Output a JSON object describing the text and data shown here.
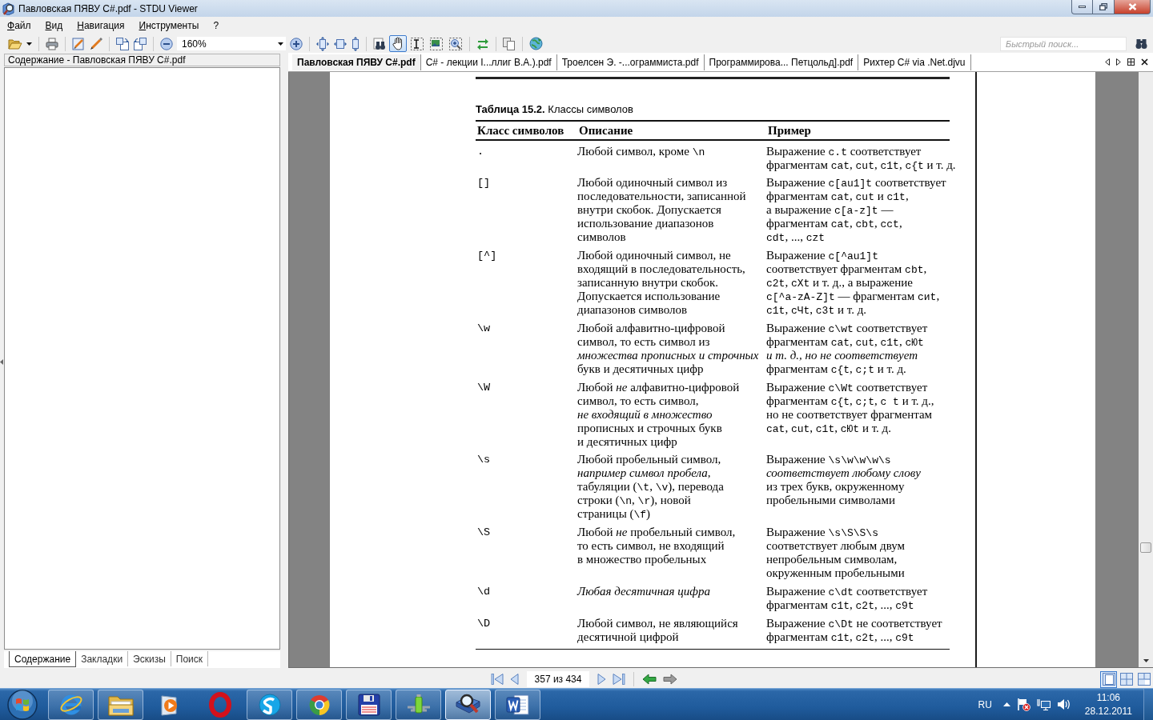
{
  "window": {
    "title": "Павловская ПЯВУ C#.pdf - STDU Viewer"
  },
  "menu": [
    "Файл",
    "Вид",
    "Навигация",
    "Инструменты",
    "?"
  ],
  "toolbar": {
    "zoom": "160%",
    "mouse_tools": [
      {
        "selected": true
      },
      {
        "selected": false
      },
      {
        "selected": false
      },
      {
        "selected": false
      }
    ],
    "quick_search": {
      "placeholder": "Быстрый поиск..."
    }
  },
  "side_panel": {
    "title": "Содержание - Павловская ПЯВУ C#.pdf",
    "tabs": [
      {
        "label": "Содержание",
        "selected": true
      },
      {
        "label": "Закладки",
        "selected": false
      },
      {
        "label": "Эскизы",
        "selected": false
      },
      {
        "label": "Поиск",
        "selected": false
      }
    ]
  },
  "document_tabs": [
    {
      "label": "Павловская ПЯВУ C#.pdf",
      "selected": true
    },
    {
      "label": "C# - лекции I...ллиг В.А.).pdf",
      "selected": false
    },
    {
      "label": "Троелсен Э. -...ограммиста.pdf",
      "selected": false
    },
    {
      "label": "Программирова... Петцольд].pdf",
      "selected": false
    },
    {
      "label": "Рихтер C# via .Net.djvu",
      "selected": false
    }
  ],
  "page": {
    "caption": "**Таблица 15.2.** Классы символов",
    "columns": [
      "Класс символов",
      "Описание",
      "Пример"
    ],
    "rows": [
      {
        "class": ".",
        "description": [
          {
            "text": "Любой символ, кроме "
          },
          {
            "text": "\\n",
            "kind": "code"
          }
        ],
        "example": [
          {
            "text": "Выражение "
          },
          {
            "text": "c.t",
            "kind": "code"
          },
          {
            "text": " соответствует\nфрагментам "
          },
          {
            "text": "cat",
            "kind": "code"
          },
          {
            "text": ", "
          },
          {
            "text": "cut",
            "kind": "code"
          },
          {
            "text": ", "
          },
          {
            "text": "c1t",
            "kind": "code"
          },
          {
            "text": ", "
          },
          {
            "text": "c{t",
            "kind": "code"
          },
          {
            "text": " и т. д."
          }
        ]
      },
      {
        "class": "[]",
        "description": [
          {
            "text": "Любой одиночный символ из\nпоследовательности, записанной\nвнутри скобок. Допускается\nиспользование диапазонов\nсимволов"
          }
        ],
        "example": [
          {
            "text": "Выражение "
          },
          {
            "text": "c[au1]t",
            "kind": "code"
          },
          {
            "text": " соответствует\nфрагментам "
          },
          {
            "text": "cat",
            "kind": "code"
          },
          {
            "text": ", "
          },
          {
            "text": "cut",
            "kind": "code"
          },
          {
            "text": " и "
          },
          {
            "text": "c1t",
            "kind": "code"
          },
          {
            "text": ",\nа выражение "
          },
          {
            "text": "c[a-z]t",
            "kind": "code"
          },
          {
            "text": " —\nфрагментам "
          },
          {
            "text": "cat",
            "kind": "code"
          },
          {
            "text": ", "
          },
          {
            "text": "cbt",
            "kind": "code"
          },
          {
            "text": ", "
          },
          {
            "text": "cct",
            "kind": "code"
          },
          {
            "text": ",\n"
          },
          {
            "text": "cdt",
            "kind": "code"
          },
          {
            "text": ", ..., "
          },
          {
            "text": "czt",
            "kind": "code"
          }
        ]
      },
      {
        "class": "[^]",
        "description": [
          {
            "text": "Любой одиночный символ, не\nвходящий в последовательность,\nзаписанную внутри скобок.\nДопускается использование\nдиапазонов символов"
          }
        ],
        "example": [
          {
            "text": "Выражение "
          },
          {
            "text": "c[^au1]t",
            "kind": "code"
          },
          {
            "text": "\nсоответствует фрагментам "
          },
          {
            "text": "cbt",
            "kind": "code"
          },
          {
            "text": ",\n"
          },
          {
            "text": "c2t",
            "kind": "code"
          },
          {
            "text": ", "
          },
          {
            "text": "cXt",
            "kind": "code"
          },
          {
            "text": " и т. д., а выражение\n"
          },
          {
            "text": "c[^a-zA-Z]t",
            "kind": "code"
          },
          {
            "text": " — фрагментам "
          },
          {
            "text": "cиt",
            "kind": "code"
          },
          {
            "text": ",\n"
          },
          {
            "text": "c1t",
            "kind": "code"
          },
          {
            "text": ", "
          },
          {
            "text": "cЧt",
            "kind": "code"
          },
          {
            "text": ", "
          },
          {
            "text": "c3t",
            "kind": "code"
          },
          {
            "text": " и т. д."
          }
        ]
      },
      {
        "class": "\\w",
        "description": [
          {
            "text": "Любой алфавитно-цифровой\nсимвол, то есть символ из\n"
          },
          {
            "text": "множества прописных и строчных",
            "kind": "italic"
          },
          {
            "text": "\nбукв и десятичных цифр"
          }
        ],
        "example": [
          {
            "text": "Выражение "
          },
          {
            "text": "c\\wt",
            "kind": "code"
          },
          {
            "text": " соответствует\nфрагментам "
          },
          {
            "text": "cat",
            "kind": "code"
          },
          {
            "text": ", "
          },
          {
            "text": "cut",
            "kind": "code"
          },
          {
            "text": ", "
          },
          {
            "text": "c1t",
            "kind": "code"
          },
          {
            "text": ", "
          },
          {
            "text": "cЮt",
            "kind": "code"
          },
          {
            "text": "\nи т. д., но не соответствует",
            "kind": "italic"
          },
          {
            "text": "\nфрагментам "
          },
          {
            "text": "c{t",
            "kind": "code"
          },
          {
            "text": ", "
          },
          {
            "text": "c;t",
            "kind": "code"
          },
          {
            "text": " и т. д."
          }
        ]
      },
      {
        "class": "\\W",
        "description": [
          {
            "text": "Любой "
          },
          {
            "text": "не",
            "kind": "italic"
          },
          {
            "text": " алфавитно-цифровой\nсимвол, то есть символ,\n"
          },
          {
            "text": "не входящий в множество",
            "kind": "italic"
          },
          {
            "text": "\nпрописных и строчных букв\nи десятичных цифр"
          }
        ],
        "example": [
          {
            "text": "Выражение "
          },
          {
            "text": "c\\Wt",
            "kind": "code"
          },
          {
            "text": " соответствует\nфрагментам "
          },
          {
            "text": "c{t",
            "kind": "code"
          },
          {
            "text": ", "
          },
          {
            "text": "c;t",
            "kind": "code"
          },
          {
            "text": ", "
          },
          {
            "text": "c t",
            "kind": "code"
          },
          {
            "text": " и т. д.,\nно не соответствует фрагментам\n"
          },
          {
            "text": "cat",
            "kind": "code"
          },
          {
            "text": ", "
          },
          {
            "text": "cut",
            "kind": "code"
          },
          {
            "text": ", "
          },
          {
            "text": "c1t",
            "kind": "code"
          },
          {
            "text": ", "
          },
          {
            "text": "cЮt",
            "kind": "code"
          },
          {
            "text": " и т. д."
          }
        ]
      },
      {
        "class": "\\s",
        "description": [
          {
            "text": "Любой пробельный символ,\n"
          },
          {
            "text": "например символ пробела,",
            "kind": "italic"
          },
          {
            "text": "\nтабуляции ("
          },
          {
            "text": "\\t",
            "kind": "code"
          },
          {
            "text": ", "
          },
          {
            "text": "\\v",
            "kind": "code"
          },
          {
            "text": "), перевода\nстроки ("
          },
          {
            "text": "\\n",
            "kind": "code"
          },
          {
            "text": ", "
          },
          {
            "text": "\\r",
            "kind": "code"
          },
          {
            "text": "), новой\nстраницы ("
          },
          {
            "text": "\\f",
            "kind": "code"
          },
          {
            "text": ")"
          }
        ],
        "example": [
          {
            "text": "Выражение "
          },
          {
            "text": "\\s\\w\\w\\w\\s",
            "kind": "code"
          },
          {
            "text": "\nсоответствует любому слову",
            "kind": "italic"
          },
          {
            "text": "\nиз трех букв, окруженному\nпробельными символами"
          }
        ]
      },
      {
        "class": "\\S",
        "description": [
          {
            "text": "Любой "
          },
          {
            "text": "не",
            "kind": "italic"
          },
          {
            "text": " пробельный символ,\nто есть символ, не входящий\nв множество пробельных"
          }
        ],
        "example": [
          {
            "text": "Выражение "
          },
          {
            "text": "\\s\\S\\S\\s",
            "kind": "code"
          },
          {
            "text": "\nсоответствует любым двум\nнепробельным символам,\nокруженным пробельными"
          }
        ]
      },
      {
        "class": "\\d",
        "description": [
          {
            "text": "Любая десятичная цифра",
            "kind": "italic"
          }
        ],
        "example": [
          {
            "text": "Выражение "
          },
          {
            "text": "c\\dt",
            "kind": "code"
          },
          {
            "text": " соответствует\nфрагментам "
          },
          {
            "text": "c1t",
            "kind": "code"
          },
          {
            "text": ", "
          },
          {
            "text": "c2t",
            "kind": "code"
          },
          {
            "text": ", ..., "
          },
          {
            "text": "c9t",
            "kind": "code"
          }
        ]
      },
      {
        "class": "\\D",
        "description": [
          {
            "text": "Любой символ, не являющийся\nдесятичной цифрой"
          }
        ],
        "example": [
          {
            "text": "Выражение "
          },
          {
            "text": "c\\Dt",
            "kind": "code"
          },
          {
            "text": " не соответствует\nфрагментам "
          },
          {
            "text": "c1t",
            "kind": "code"
          },
          {
            "text": ", "
          },
          {
            "text": "c2t",
            "kind": "code"
          },
          {
            "text": ", ..., "
          },
          {
            "text": "c9t",
            "kind": "code"
          }
        ]
      }
    ]
  },
  "navigation": {
    "page": "357 из 434",
    "view_modes": [
      {
        "selected": true
      },
      {
        "selected": false
      },
      {
        "selected": false
      }
    ]
  },
  "taskbar": {
    "apps": [
      {
        "running": true,
        "selected": false
      },
      {
        "running": true,
        "selected": false
      },
      {
        "running": false,
        "selected": false
      },
      {
        "running": false,
        "selected": false
      },
      {
        "running": true,
        "selected": false
      },
      {
        "running": true,
        "selected": false
      },
      {
        "running": true,
        "selected": false
      },
      {
        "running": true,
        "selected": false
      },
      {
        "running": true,
        "selected": true
      },
      {
        "running": true,
        "selected": false
      }
    ],
    "language": "RU",
    "time": "11:06",
    "date": "28.12.2011"
  }
}
